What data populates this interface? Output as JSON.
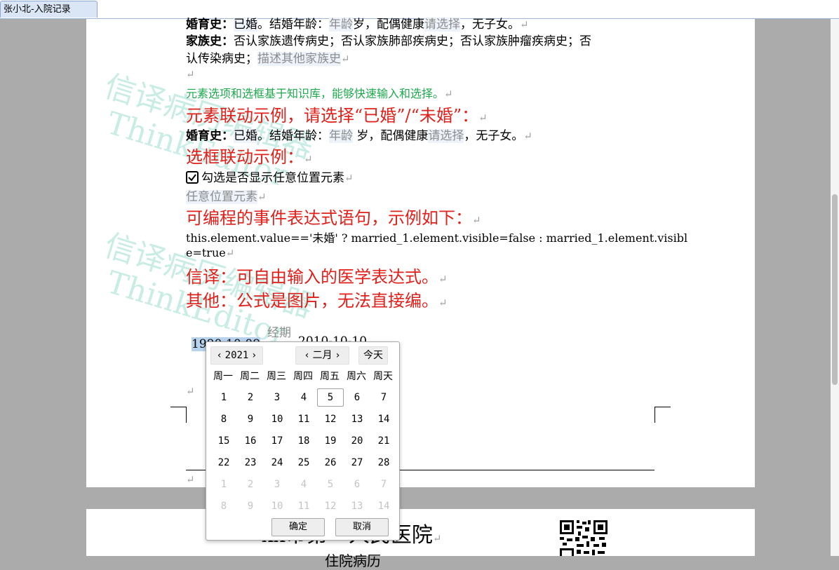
{
  "tab": {
    "title": "张小北-入院记录"
  },
  "doc": {
    "marriage1": {
      "label": "婚育史：",
      "status": "已婚",
      "age_label": "。结婚年龄：",
      "age_ph": "年龄",
      "age_unit": "岁，配偶健康",
      "spouse_ph": "请选择",
      "kids": "，无子女。"
    },
    "family": {
      "label": "家族史：",
      "text1": "否认家族遗传病史；否认家族肺部疾病史；否认家族肿瘤疾病史；否",
      "text2": "认传染病史",
      "sep": "；",
      "ph": "描述其他家族史"
    },
    "green_note": "元素选项和选框基于知识库，能够快速输入和选择。",
    "red1": "元素联动示例，请选择“已婚”/“未婚”：",
    "marriage2": {
      "label": "婚育史：",
      "status": "已婚",
      "age_label": "。结婚年龄：",
      "age_ph": "年龄",
      "age_unit": " 岁，配偶健康",
      "spouse_ph": "请选择",
      "kids": "，无子女。"
    },
    "red2": "选框联动示例：",
    "checkbox_label": "勾选是否显示任意位置元素",
    "any_pos_ph": "任意位置元素",
    "red3": "可编程的事件表达式语句，示例如下：",
    "expr1": "this.element.value=='未婚' ? married_1.element.visible=false : married_1.element.visibl",
    "expr2": "e=true",
    "red4": "信译：可自由输入的医学表达式。",
    "red5": "其他：公式是图片，无法直接编。",
    "period_label": "经期",
    "date1": "1990-10-09",
    "date2": "2010-10-10",
    "watermark1": "信译病历编辑器",
    "watermark2": "ThinkEditor",
    "hospital_name": "xx市第一人民医院",
    "record_type": "住院病历"
  },
  "calendar": {
    "year": "2021",
    "month": "二月",
    "today_btn": "今天",
    "weekdays": [
      "周一",
      "周二",
      "周三",
      "周四",
      "周五",
      "周六",
      "周天"
    ],
    "rows": [
      [
        "1",
        "2",
        "3",
        "4",
        "5",
        "6",
        "7"
      ],
      [
        "8",
        "9",
        "10",
        "11",
        "12",
        "13",
        "14"
      ],
      [
        "15",
        "16",
        "17",
        "18",
        "19",
        "20",
        "21"
      ],
      [
        "22",
        "23",
        "24",
        "25",
        "26",
        "27",
        "28"
      ],
      [
        "1",
        "2",
        "3",
        "4",
        "5",
        "6",
        "7"
      ],
      [
        "8",
        "9",
        "10",
        "11",
        "12",
        "13",
        "14"
      ]
    ],
    "selected_day": "5",
    "ok": "确定",
    "cancel": "取消"
  },
  "colors": {
    "red": "#e0201b",
    "green": "#1ea84d",
    "placeholder": "#8c8c8c"
  }
}
